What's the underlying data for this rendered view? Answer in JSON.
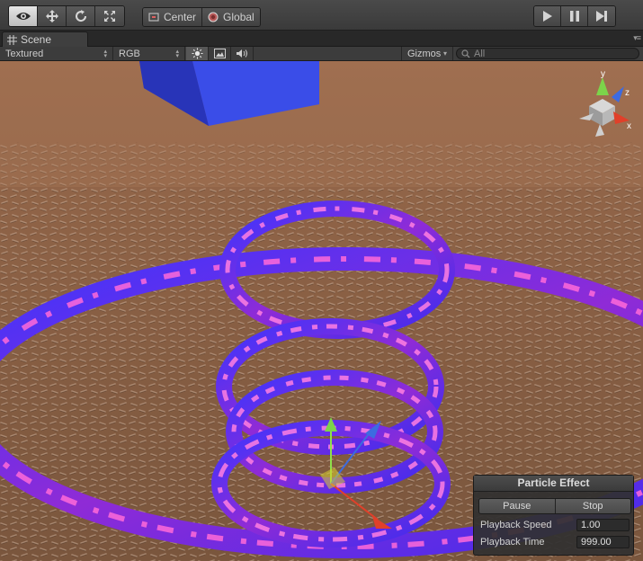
{
  "toolbar": {
    "tools": [
      {
        "name": "view-tool-button",
        "icon": "eye-icon",
        "active": true
      },
      {
        "name": "move-tool-button",
        "icon": "move-arrows-icon",
        "active": false
      },
      {
        "name": "rotate-tool-button",
        "icon": "rotate-icon",
        "active": false
      },
      {
        "name": "scale-tool-button",
        "icon": "scale-icon",
        "active": false
      }
    ],
    "pivot_label": "Center",
    "space_label": "Global"
  },
  "tabs": {
    "scene_label": "Scene"
  },
  "scene_bar": {
    "render_mode": "Textured",
    "color_mode": "RGB",
    "gizmos_label": "Gizmos",
    "search_placeholder": "All"
  },
  "gizmo": {
    "x_label": "x",
    "y_label": "y",
    "z_label": "z"
  },
  "particle_panel": {
    "title": "Particle Effect",
    "pause_label": "Pause",
    "stop_label": "Stop",
    "speed_label": "Playback Speed",
    "speed_value": "1.00",
    "time_label": "Playback Time",
    "time_value": "999.00"
  },
  "colors": {
    "ring_outer": "#2a2cff",
    "ring_inner": "#ff6ad8",
    "cube": "#3b4fe6",
    "ground": "#8a5a3c",
    "axis_x": "#e0402a",
    "axis_y": "#7cd44a",
    "axis_z": "#3d6be0"
  }
}
